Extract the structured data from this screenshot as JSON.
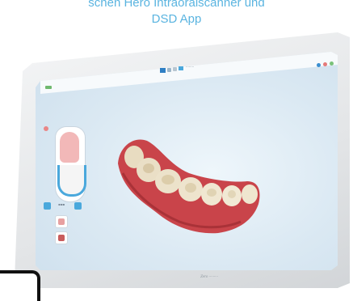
{
  "caption": {
    "line1": "schen Hero Intraoralscanner und",
    "line2": "DSD App"
  },
  "monitor": {
    "brand": "Zero ·········",
    "toolbar_text": "········",
    "colors": {
      "accent": "#4aa8dc",
      "gingiva": "#c84a4a",
      "tooth": "#e9dcc0"
    }
  },
  "icons": {
    "window_controls": [
      "blue-dot",
      "red-dot",
      "green-dot"
    ],
    "toolbar": [
      "flag-icon",
      "tools-icon",
      "view-icon"
    ],
    "side": [
      "left-arrow-icon",
      "right-arrow-icon"
    ],
    "bottom": [
      "scan-icon",
      "camera-icon"
    ]
  }
}
